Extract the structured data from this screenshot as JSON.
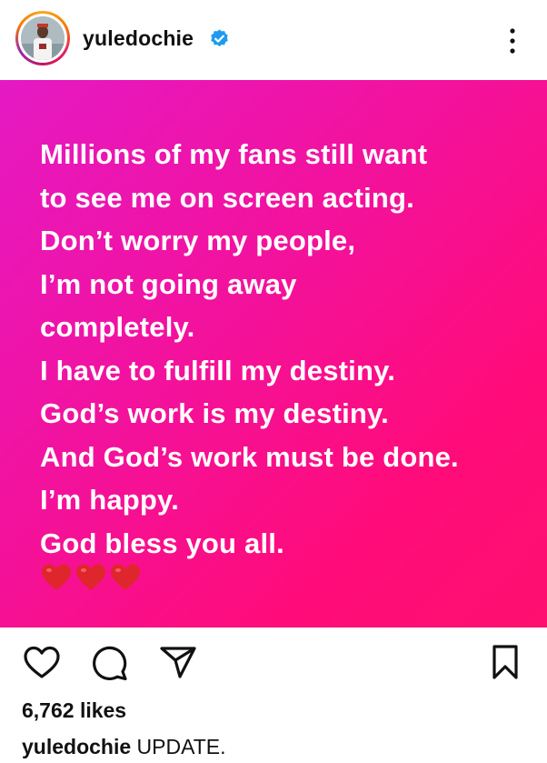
{
  "header": {
    "username": "yuledochie",
    "verified": true,
    "avatar_icon": "profile-photo",
    "more_icon": "more-vertical-icon"
  },
  "post": {
    "lines": [
      "Millions of my fans still want",
      "to see me on screen acting.",
      "Don’t worry my people,",
      "I’m not going away",
      "completely.",
      "I have to fulfill my destiny.",
      "God’s work is my destiny.",
      "And God’s work must be done.",
      "I’m happy.",
      "God bless you all."
    ],
    "hearts": 3,
    "colors": {
      "gradient_start": "#e519c4",
      "gradient_end": "#ff0f6f",
      "heart": "#e0262d",
      "verified": "#1d9bf0"
    }
  },
  "actions": {
    "like_icon": "heart-outline-icon",
    "comment_icon": "comment-bubble-icon",
    "share_icon": "paper-plane-icon",
    "save_icon": "bookmark-icon"
  },
  "likes": "6,762 likes",
  "caption": {
    "username": "yuledochie",
    "text": "UPDATE."
  }
}
